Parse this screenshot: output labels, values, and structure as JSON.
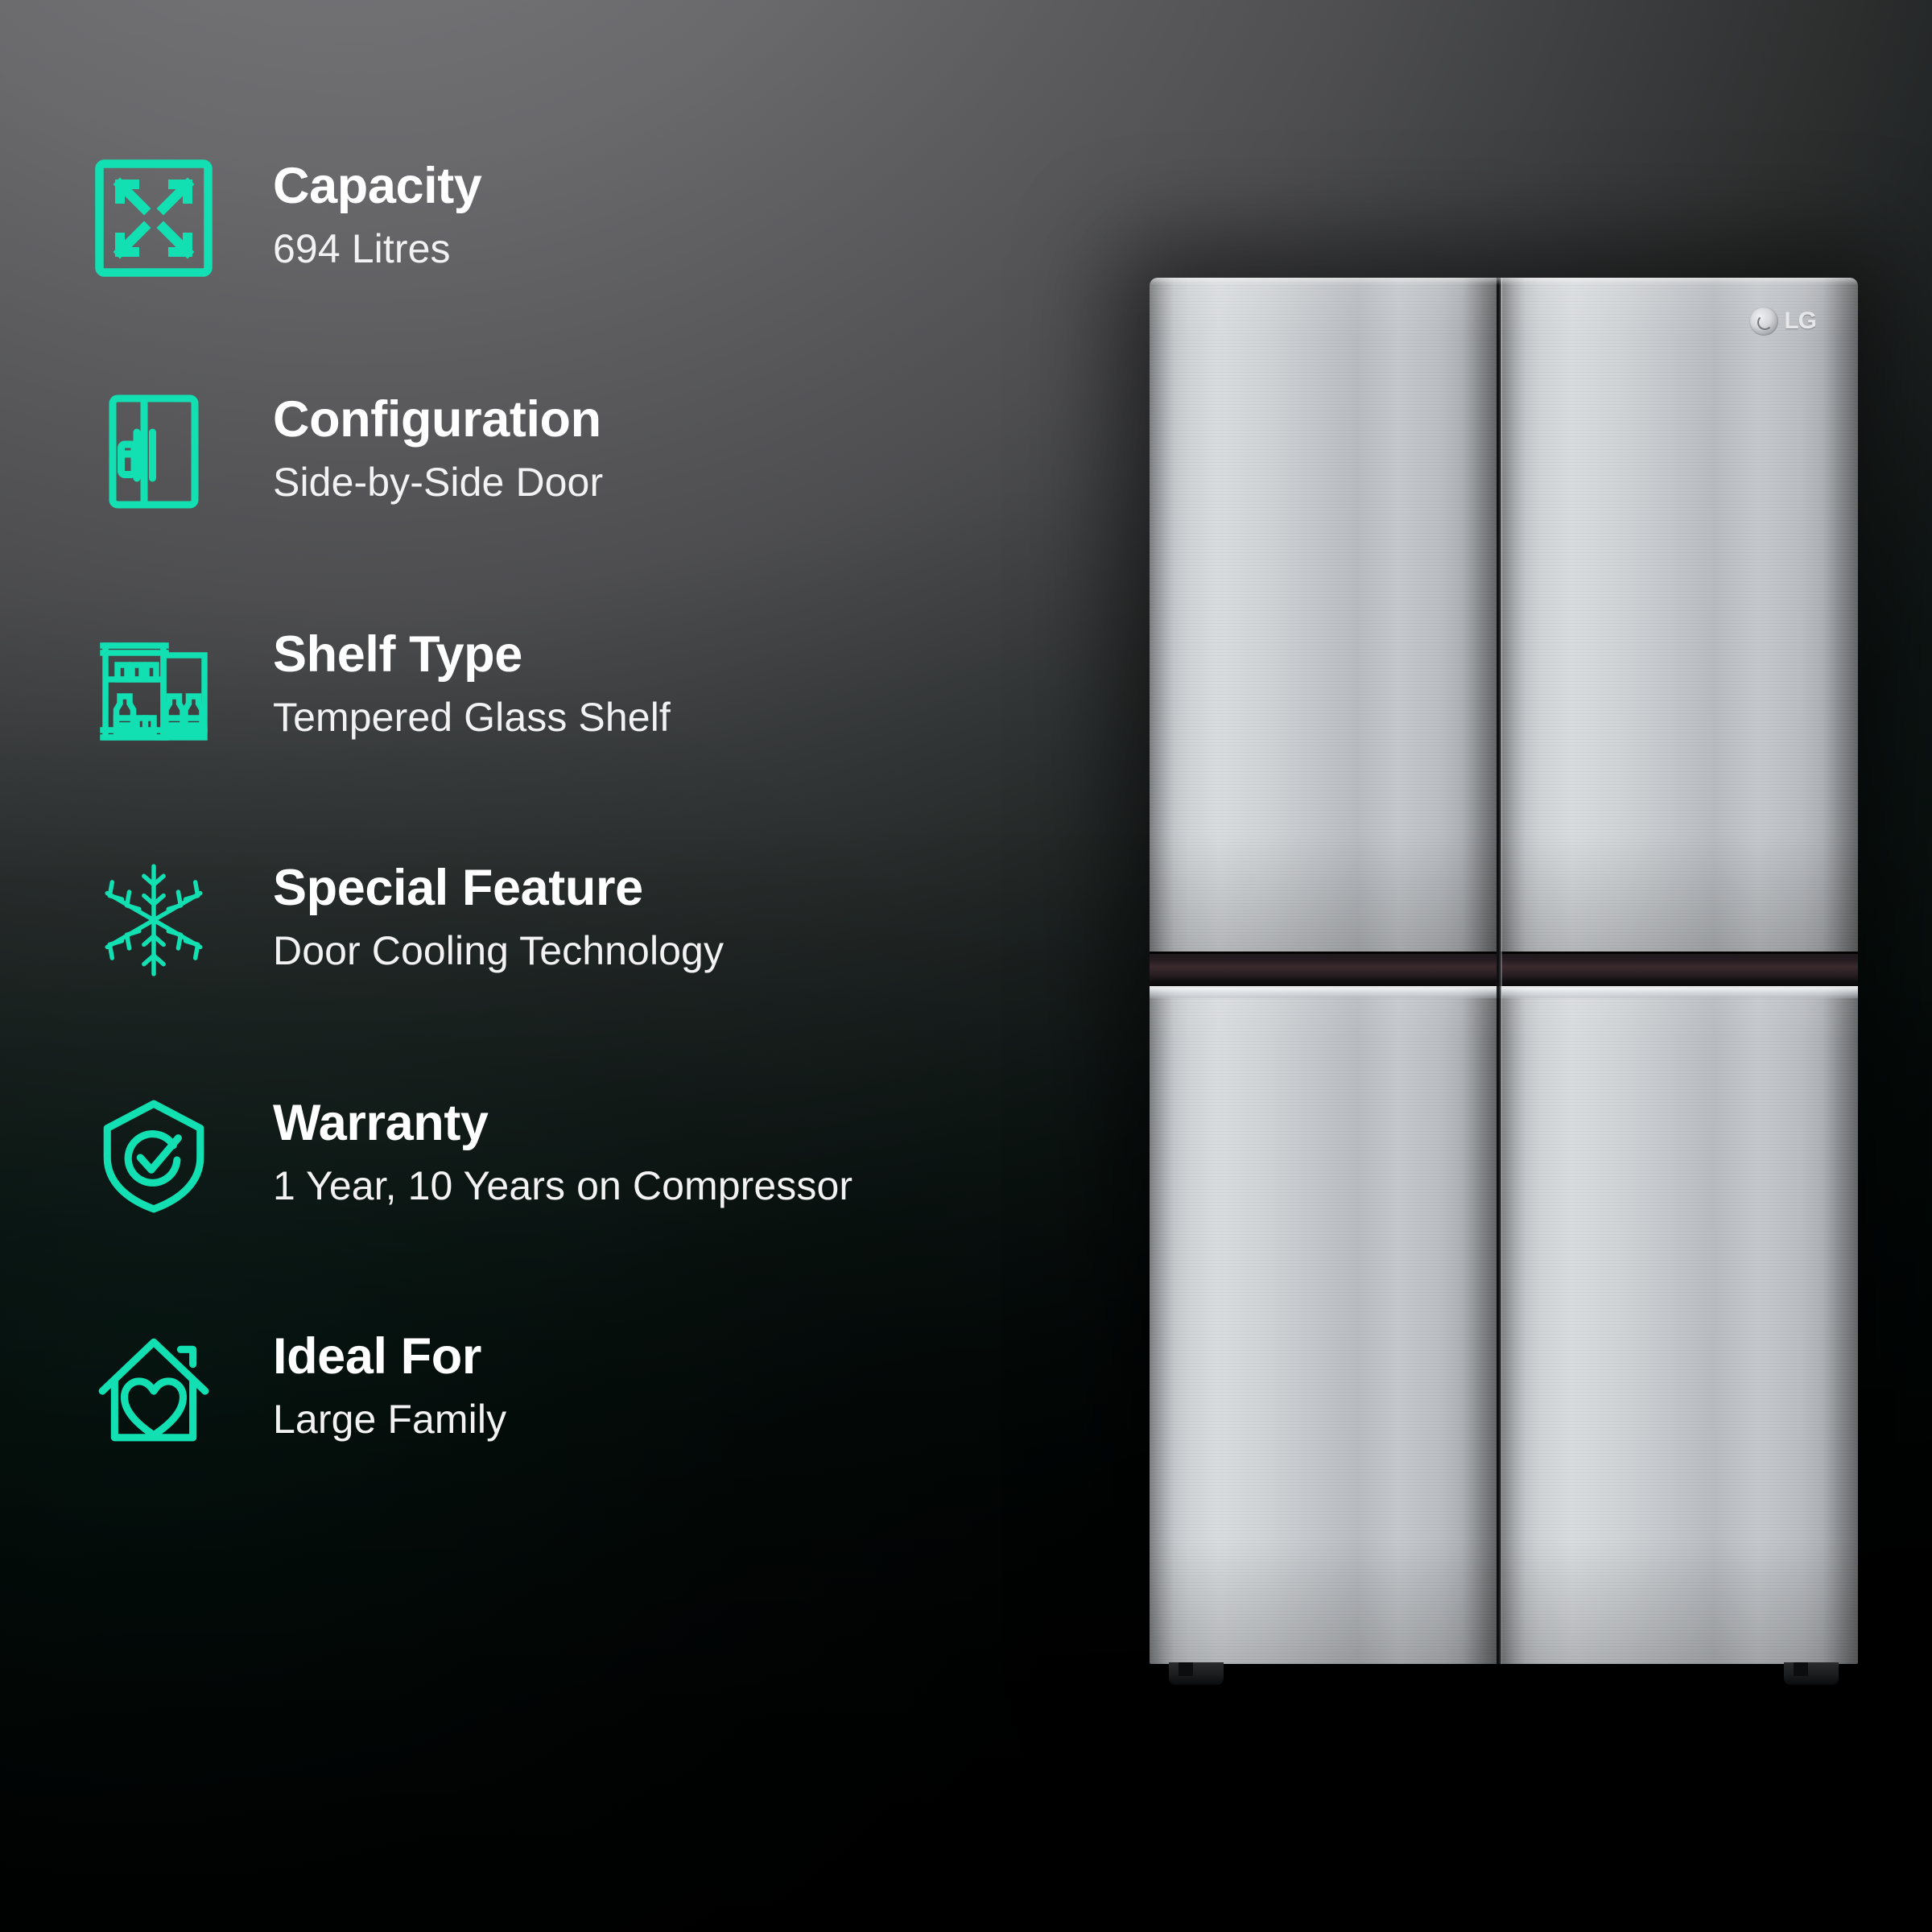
{
  "theme": {
    "accent_color": "#12E0B2",
    "title_color": "#FFFFFF",
    "value_color": "#F2F2F2",
    "background_light": "#6B6B6E",
    "background_dark": "#000000"
  },
  "specs": [
    {
      "icon": "expand-arrows-icon",
      "title": "Capacity",
      "value": "694 Litres"
    },
    {
      "icon": "side-by-side-fridge-icon",
      "title": "Configuration",
      "value": "Side-by-Side Door"
    },
    {
      "icon": "shelf-bottles-icon",
      "title": "Shelf Type",
      "value": "Tempered Glass Shelf"
    },
    {
      "icon": "snowflake-icon",
      "title": "Special Feature",
      "value": "Door Cooling Technology"
    },
    {
      "icon": "shield-check-icon",
      "title": "Warranty",
      "value": "1 Year, 10 Years on Compressor"
    },
    {
      "icon": "house-heart-icon",
      "title": "Ideal For",
      "value": "Large Family"
    }
  ],
  "product": {
    "brand": "LG",
    "brand_mark": "lg-roundel-icon",
    "type": "side-by-side-refrigerator-image",
    "finish": "brushed-stainless-steel"
  }
}
